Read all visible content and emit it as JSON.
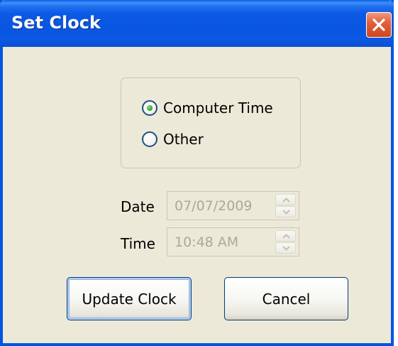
{
  "window": {
    "title": "Set Clock"
  },
  "source_group": {
    "options": [
      {
        "label": "Computer Time",
        "selected": true
      },
      {
        "label": "Other",
        "selected": false
      }
    ]
  },
  "date_field": {
    "label": "Date",
    "value": "07/07/2009",
    "enabled": false
  },
  "time_field": {
    "label": "Time",
    "value": "10:48 AM",
    "enabled": false
  },
  "buttons": {
    "update_label": "Update Clock",
    "cancel_label": "Cancel"
  },
  "colors": {
    "titlebar": "#0a56e0",
    "window_body": "#ece9d8",
    "close_button": "#e2603c",
    "radio_selected": "#34b034",
    "disabled_text": "#aca899"
  },
  "icons": {
    "close": "close-icon",
    "spin_up": "chevron-up-icon",
    "spin_down": "chevron-down-icon"
  }
}
